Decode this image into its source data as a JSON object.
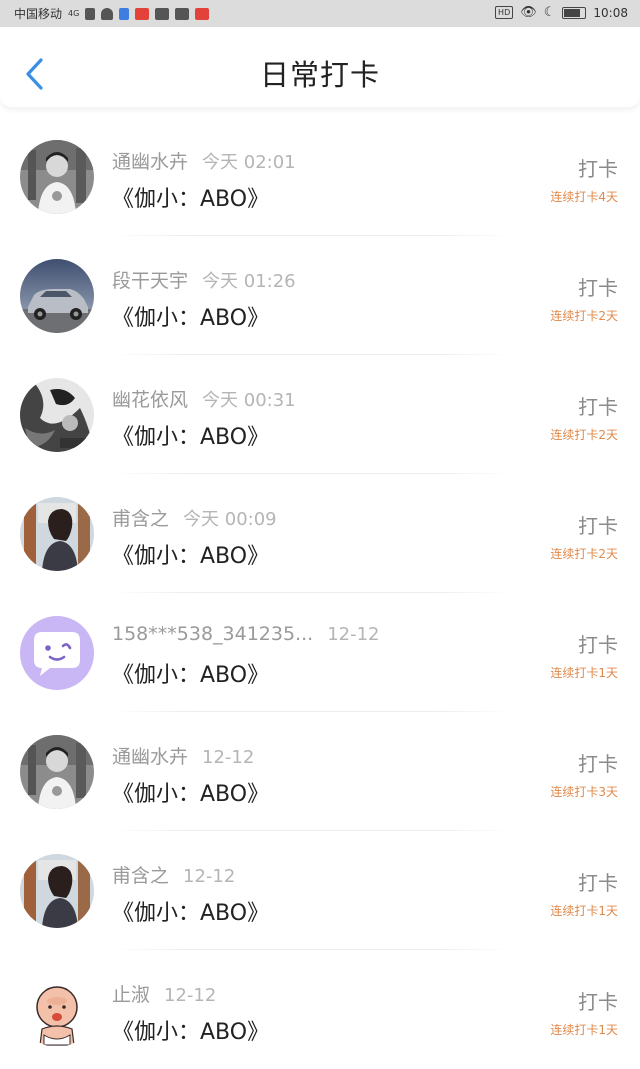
{
  "statusbar": {
    "carrier": "中国移动",
    "signal": "4G",
    "time": "10:08",
    "hd_label": "HD"
  },
  "header": {
    "title": "日常打卡"
  },
  "records": [
    {
      "name": "通幽水卉",
      "time": "今天 02:01",
      "book": "《伽小：ABO》",
      "action": "打卡",
      "streak": "连续打卡4天",
      "avatar": "photo-portrait"
    },
    {
      "name": "段干天宇",
      "time": "今天 01:26",
      "book": "《伽小：ABO》",
      "action": "打卡",
      "streak": "连续打卡2天",
      "avatar": "photo-car"
    },
    {
      "name": "幽花依风",
      "time": "今天 00:31",
      "book": "《伽小：ABO》",
      "action": "打卡",
      "streak": "连续打卡2天",
      "avatar": "photo-bw"
    },
    {
      "name": "甫含之",
      "time": "今天 00:09",
      "book": "《伽小：ABO》",
      "action": "打卡",
      "streak": "连续打卡2天",
      "avatar": "photo-girl"
    },
    {
      "name": "158***538_341235...",
      "time": "12-12",
      "book": "《伽小：ABO》",
      "action": "打卡",
      "streak": "连续打卡1天",
      "avatar": "default-chat"
    },
    {
      "name": "通幽水卉",
      "time": "12-12",
      "book": "《伽小：ABO》",
      "action": "打卡",
      "streak": "连续打卡3天",
      "avatar": "photo-portrait"
    },
    {
      "name": "甫含之",
      "time": "12-12",
      "book": "《伽小：ABO》",
      "action": "打卡",
      "streak": "连续打卡1天",
      "avatar": "photo-girl"
    },
    {
      "name": "止淑",
      "time": "12-12",
      "book": "《伽小：ABO》",
      "action": "打卡",
      "streak": "连续打卡1天",
      "avatar": "cartoon-baby"
    }
  ],
  "colors": {
    "statusbar_bg": "#dcdcdc",
    "back_arrow": "#3a8ee6",
    "streak": "#e0894a",
    "name": "#9a9a9a",
    "chat_avatar_bg": "#c9b6f4"
  }
}
